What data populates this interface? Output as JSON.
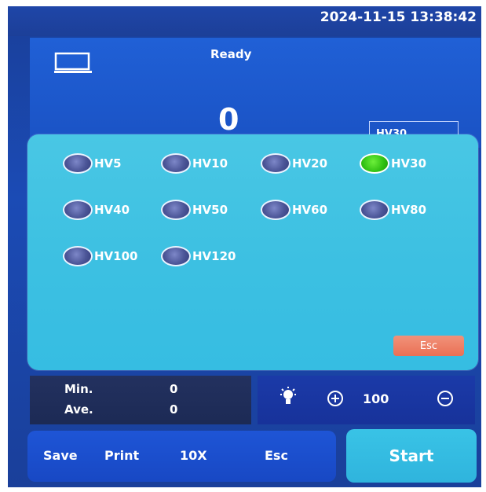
{
  "header": {
    "datetime": "2024-11-15 13:38:42"
  },
  "status": {
    "text": "Ready",
    "count": "0",
    "selected_scale": "HV30"
  },
  "scale_popup": {
    "options": [
      {
        "label": "HV5",
        "selected": false
      },
      {
        "label": "HV10",
        "selected": false
      },
      {
        "label": "HV20",
        "selected": false
      },
      {
        "label": "HV30",
        "selected": true
      },
      {
        "label": "HV40",
        "selected": false
      },
      {
        "label": "HV50",
        "selected": false
      },
      {
        "label": "HV60",
        "selected": false
      },
      {
        "label": "HV80",
        "selected": false
      },
      {
        "label": "HV100",
        "selected": false
      },
      {
        "label": "HV120",
        "selected": false
      }
    ],
    "esc_label": "Esc"
  },
  "stats": {
    "min_label": "Min.",
    "min_value": "0",
    "ave_label": "Ave.",
    "ave_value": "0"
  },
  "light": {
    "value": "100"
  },
  "toolbar": {
    "save": "Save",
    "print": "Print",
    "zoom": "10X",
    "esc": "Esc",
    "start": "Start"
  },
  "colors": {
    "selected_radio": "#2fbf12",
    "popup_bg": "#3cc0e2",
    "esc_button": "#ea7055"
  }
}
